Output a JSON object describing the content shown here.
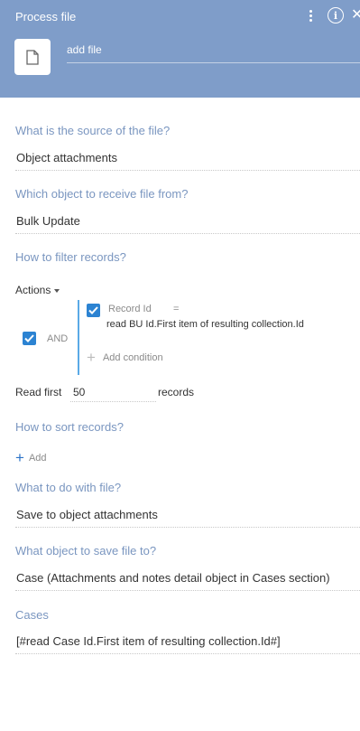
{
  "header": {
    "title": "Process file",
    "name_value": "add file",
    "icons": {
      "file": "file-icon",
      "menu": "kebab-menu-icon",
      "info": "info-icon",
      "close": "close-icon"
    }
  },
  "source": {
    "label": "What is the source of the file?",
    "value": "Object attachments"
  },
  "receive_from": {
    "label": "Which object to receive file from?",
    "value": "Bulk Update"
  },
  "filter": {
    "label": "How to filter records?",
    "actions_label": "Actions",
    "group_operator": "AND",
    "condition": {
      "column": "Record Id",
      "operator": "=",
      "value": "read BU Id.First item of resulting collection.Id"
    },
    "add_condition_label": "Add condition"
  },
  "read_first": {
    "label": "Read first",
    "value": "50",
    "suffix": "records"
  },
  "sort": {
    "label": "How to sort records?",
    "add_label": "Add"
  },
  "action": {
    "label": "What to do with file?",
    "value": "Save to object attachments"
  },
  "save_to": {
    "label": "What object to save file to?",
    "value": "Case (Attachments and notes detail object in Cases section)"
  },
  "cases": {
    "label": "Cases",
    "value": "[#read Case Id.First item of resulting collection.Id#]"
  },
  "colors": {
    "header_bg": "#7f9dc9",
    "label": "#7a96c0",
    "checkbox": "#2c83d2",
    "accent": "#5aa9e6"
  }
}
